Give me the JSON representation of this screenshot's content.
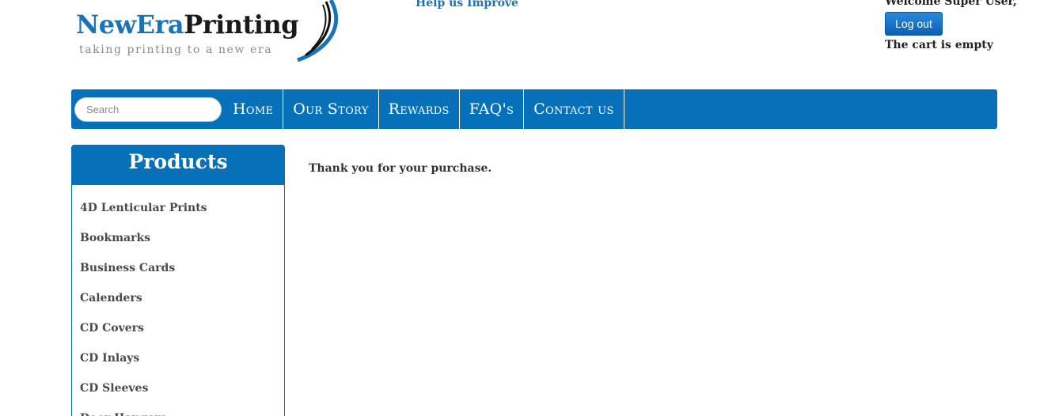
{
  "logo": {
    "name_part1": "NewEra",
    "name_part2": "Printing",
    "tagline": "taking printing to a new era"
  },
  "header": {
    "help_link": "Help us Improve",
    "welcome": "Welcome Super User,",
    "logout_label": "Log out",
    "cart_status": "The cart is empty"
  },
  "nav": {
    "search_placeholder": "Search",
    "items": [
      {
        "label": "Home"
      },
      {
        "label": "Our Story"
      },
      {
        "label": "Rewards"
      },
      {
        "label": "FAQ's"
      },
      {
        "label": "Contact us"
      }
    ]
  },
  "sidebar": {
    "title": "Products",
    "items": [
      {
        "label": "4D Lenticular Prints"
      },
      {
        "label": "Bookmarks"
      },
      {
        "label": "Business Cards"
      },
      {
        "label": "Calenders"
      },
      {
        "label": "CD Covers"
      },
      {
        "label": "CD Inlays"
      },
      {
        "label": "CD Sleeves"
      },
      {
        "label": "Door Hangers"
      }
    ]
  },
  "main": {
    "message": "Thank you for your purchase."
  },
  "colors": {
    "brand_blue": "#0670b8",
    "link_blue": "#1a73b8"
  }
}
